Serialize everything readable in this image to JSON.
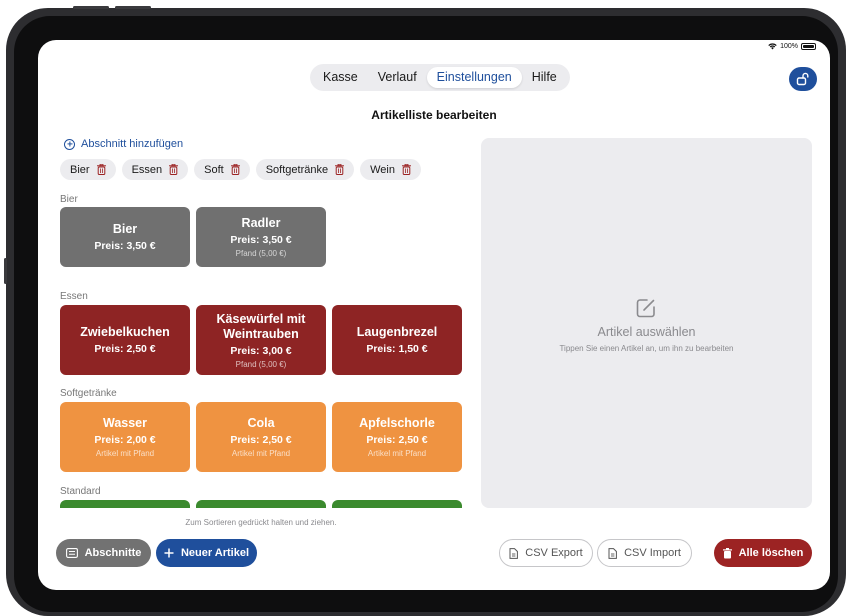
{
  "status": {
    "battery": "100%"
  },
  "tabs": [
    {
      "label": "Kasse",
      "active": false
    },
    {
      "label": "Verlauf",
      "active": false
    },
    {
      "label": "Einstellungen",
      "active": true
    },
    {
      "label": "Hilfe",
      "active": false
    }
  ],
  "page_title": "Artikelliste bearbeiten",
  "add_section_label": "Abschnitt hinzufügen",
  "section_chips": [
    "Bier",
    "Essen",
    "Soft",
    "Softgetränke",
    "Wein"
  ],
  "sections": [
    {
      "name": "Bier",
      "items": [
        {
          "name": "Bier",
          "price": "Preis: 3,50 €",
          "sub": "",
          "color": "#707070"
        },
        {
          "name": "Radler",
          "price": "Preis: 3,50 €",
          "sub": "Pfand (5,00 €)",
          "color": "#707070"
        }
      ]
    },
    {
      "name": "Essen",
      "items": [
        {
          "name": "Zwiebelkuchen",
          "price": "Preis: 2,50 €",
          "sub": "",
          "color": "#8e2424"
        },
        {
          "name": "Käsewürfel mit Weintrauben",
          "price": "Preis: 3,00 €",
          "sub": "Pfand (5,00 €)",
          "color": "#8e2424"
        },
        {
          "name": "Laugenbrezel",
          "price": "Preis: 1,50 €",
          "sub": "",
          "color": "#8e2424"
        }
      ]
    },
    {
      "name": "Softgetränke",
      "items": [
        {
          "name": "Wasser",
          "price": "Preis: 2,00 €",
          "sub": "Artikel mit Pfand",
          "color": "#ef9341"
        },
        {
          "name": "Cola",
          "price": "Preis: 2,50 €",
          "sub": "Artikel mit Pfand",
          "color": "#ef9341"
        },
        {
          "name": "Apfelschorle",
          "price": "Preis: 2,50 €",
          "sub": "Artikel mit Pfand",
          "color": "#ef9341"
        }
      ]
    },
    {
      "name": "Standard",
      "items": []
    }
  ],
  "detail": {
    "title": "Artikel auswählen",
    "hint": "Tippen Sie einen Artikel an, um ihn zu bearbeiten"
  },
  "sort_hint": "Zum Sortieren gedrückt halten und ziehen.",
  "buttons": {
    "sections": "Abschnitte",
    "new_item": "Neuer Artikel",
    "csv_export": "CSV Export",
    "csv_import": "CSV Import",
    "delete_all": "Alle löschen"
  },
  "colors": {
    "accent": "#1f4f9c",
    "danger": "#9c2323",
    "bier": "#707070",
    "essen": "#8e2424",
    "softgetraenke": "#ef9341",
    "standard": "#3b8a2e"
  }
}
